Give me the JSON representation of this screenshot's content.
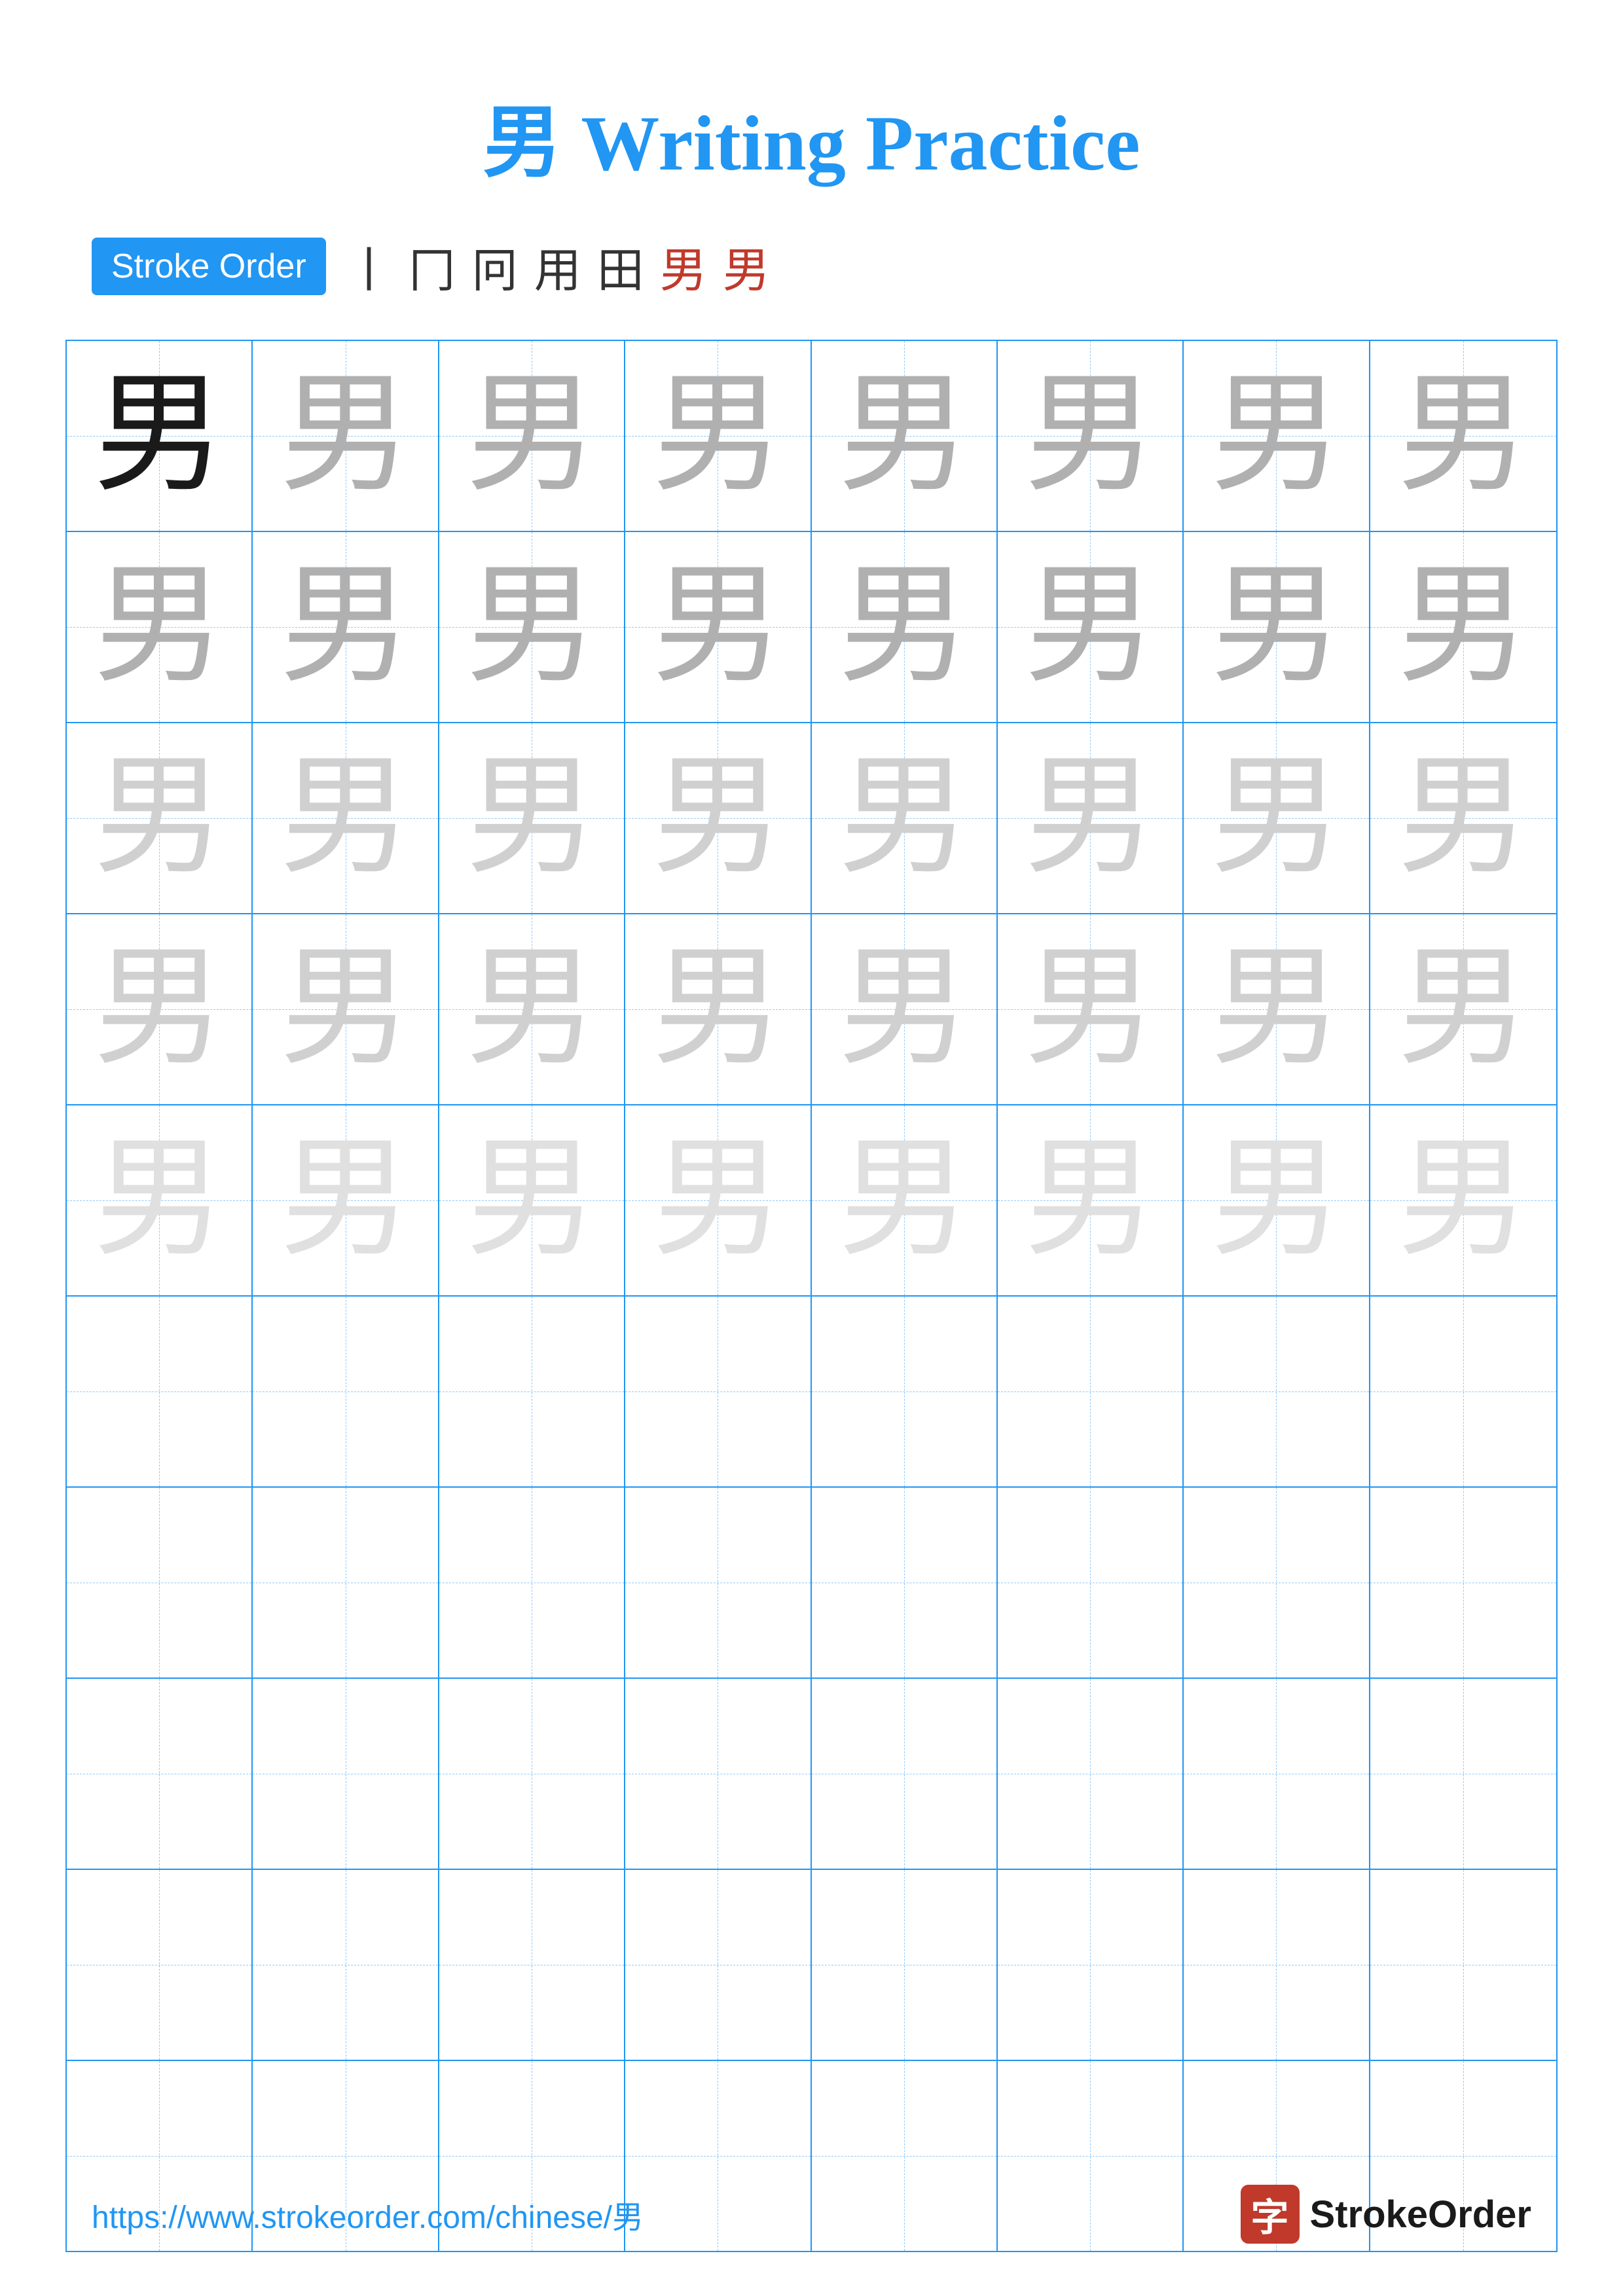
{
  "page": {
    "title": "男 Writing Practice",
    "stroke_order_label": "Stroke Order",
    "stroke_order_chars": [
      "丨",
      "冂",
      "冋",
      "用",
      "田",
      "男",
      "男"
    ],
    "character": "男",
    "footer_url": "https://www.strokeorder.com/chinese/男",
    "footer_logo_char": "字",
    "footer_logo_name": "StrokeOrder"
  },
  "grid": {
    "rows": 10,
    "cols": 8,
    "cell_heights": [
      290,
      290,
      290,
      290,
      290,
      290,
      290,
      290,
      290,
      290
    ],
    "char_levels": [
      [
        "dark",
        "medium",
        "medium",
        "medium",
        "medium",
        "medium",
        "medium",
        "medium"
      ],
      [
        "medium",
        "medium",
        "medium",
        "medium",
        "medium",
        "medium",
        "medium",
        "medium"
      ],
      [
        "light",
        "light",
        "light",
        "light",
        "light",
        "light",
        "light",
        "light"
      ],
      [
        "light",
        "light",
        "light",
        "light",
        "light",
        "light",
        "light",
        "light"
      ],
      [
        "very-light",
        "very-light",
        "very-light",
        "very-light",
        "very-light",
        "very-light",
        "very-light",
        "very-light"
      ],
      [
        "none",
        "none",
        "none",
        "none",
        "none",
        "none",
        "none",
        "none"
      ],
      [
        "none",
        "none",
        "none",
        "none",
        "none",
        "none",
        "none",
        "none"
      ],
      [
        "none",
        "none",
        "none",
        "none",
        "none",
        "none",
        "none",
        "none"
      ],
      [
        "none",
        "none",
        "none",
        "none",
        "none",
        "none",
        "none",
        "none"
      ],
      [
        "none",
        "none",
        "none",
        "none",
        "none",
        "none",
        "none",
        "none"
      ]
    ]
  }
}
